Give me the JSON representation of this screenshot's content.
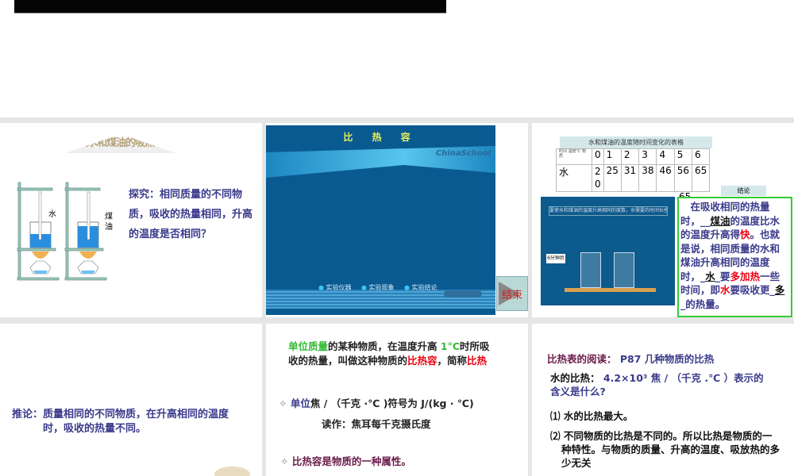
{
  "slides": [
    {
      "wordart": "比较水和煤油的吸热本领",
      "labels": {
        "water": "水",
        "kerosene": "煤油"
      },
      "text": "探究：相同质量的不同物质，吸收的热量相同，升高的温度是否相同？"
    },
    {
      "title": "比 热 容",
      "brand": "ChinaSchool",
      "nav": [
        "实验仪器",
        "实验现象",
        "实验结论"
      ],
      "end_button": "结束"
    },
    {
      "table_caption": "水和煤油的温度随时间变化的表格",
      "corner": {
        "time": "时间",
        "temp": "温度℃",
        "substance": "物质"
      },
      "header": [
        "0",
        "1",
        "2",
        "3",
        "4",
        "5",
        "6"
      ],
      "water_label": "水",
      "water": [
        "20",
        "25",
        "31",
        "38",
        "46",
        "56",
        "65"
      ],
      "kerosene_last": "65",
      "banner": "要使水和煤油的温度升高相同的度数，水需要的时间长些。",
      "timer": "6分钟后",
      "conclusion_label": "结论",
      "conclusion": {
        "p1": "在吸收相同的热量时，",
        "b1": "煤油",
        "p2": "的温度比水的温度升高得",
        "r1": "快",
        "p3": "。也就是说，相同质量的水和煤油升高相同的温度时，",
        "b2": "水",
        "p4": "要",
        "r2": "多加热",
        "p5": "一些时间，即",
        "r3": "水",
        "p6": "要吸收更",
        "b3": "多",
        "p7": "的热量。"
      }
    },
    {
      "label": "推论：",
      "text": "质量相同的不同物质，在升高相同的温度时，吸收的热量不同。"
    },
    {
      "g1": "单位质量",
      "t1": "的某种物质，在温度升高 ",
      "g2": "1°C",
      "t2": "时所吸收的热量，叫做这种物质的",
      "r1": "比热容",
      "t3": "，简称",
      "r2": "比热",
      "unit_label": "单位",
      "unit": "焦 / （千克 ·℃ )符号为 J/(kg · ℃)",
      "reading": "读作：焦耳每千克摄氏度",
      "property": "比热容是物质的一种属性。"
    },
    {
      "heading": "比热表的阅读：",
      "ref": "P87 几种物质的比热",
      "q_label": "水的比热：",
      "q": "4.2×10³ 焦 / （千克 .℃ ）表示的含义是什么?",
      "a1": "⑴ 水的比热最大。",
      "a2": "⑵ 不同物质的比热是不同的。所以比热是物质的一种特性。与物质的质量、升高的温度、吸放热的多少无关"
    }
  ]
}
